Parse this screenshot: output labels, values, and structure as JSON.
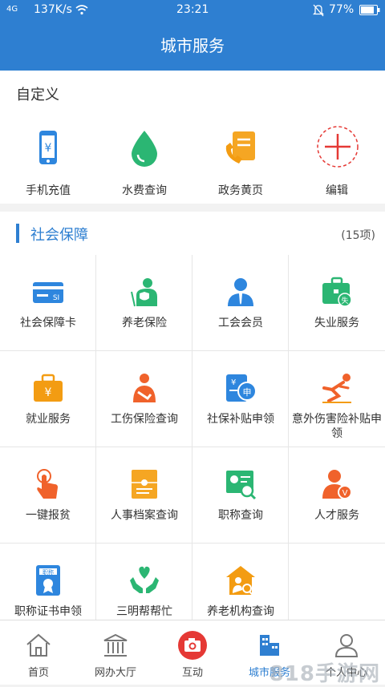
{
  "status": {
    "signal": "4G",
    "speed": "137K/s",
    "time": "23:21",
    "battery": "77%"
  },
  "appbar": {
    "title": "城市服务"
  },
  "custom": {
    "title": "自定义",
    "items": [
      {
        "label": "手机充值",
        "icon": "phone-recharge-icon"
      },
      {
        "label": "水费查询",
        "icon": "water-drop-icon"
      },
      {
        "label": "政务黄页",
        "icon": "yellow-pages-icon"
      },
      {
        "label": "编辑",
        "icon": "add-icon"
      }
    ]
  },
  "section": {
    "title": "社会保障",
    "count": "(15项)"
  },
  "grid": [
    {
      "label": "社会保障卡",
      "icon": "social-security-card-icon"
    },
    {
      "label": "养老保险",
      "icon": "pension-insurance-icon"
    },
    {
      "label": "工会会员",
      "icon": "union-member-icon"
    },
    {
      "label": "失业服务",
      "icon": "unemployment-service-icon"
    },
    {
      "label": "就业服务",
      "icon": "employment-service-icon"
    },
    {
      "label": "工伤保险查询",
      "icon": "injury-insurance-icon"
    },
    {
      "label": "社保补贴申领",
      "icon": "subsidy-apply-icon"
    },
    {
      "label": "意外伤害险补贴申领",
      "icon": "accident-insurance-icon"
    },
    {
      "label": "一键报贫",
      "icon": "one-tap-report-icon"
    },
    {
      "label": "人事档案查询",
      "icon": "personnel-file-icon"
    },
    {
      "label": "职称查询",
      "icon": "title-query-icon"
    },
    {
      "label": "人才服务",
      "icon": "talent-service-icon"
    },
    {
      "label": "职称证书申领",
      "icon": "title-certificate-icon"
    },
    {
      "label": "三明帮帮忙",
      "icon": "helping-hands-icon"
    },
    {
      "label": "养老机构查询",
      "icon": "elderly-institution-icon"
    }
  ],
  "tabs": [
    {
      "label": "首页",
      "icon": "home-icon"
    },
    {
      "label": "网办大厅",
      "icon": "hall-icon"
    },
    {
      "label": "互动",
      "icon": "camera-icon"
    },
    {
      "label": "城市服务",
      "icon": "city-service-icon",
      "active": true
    },
    {
      "label": "个人中心",
      "icon": "user-icon"
    }
  ],
  "watermark": "818手游网",
  "colors": {
    "primary": "#2e7fd1",
    "orange": "#f39c12",
    "green": "#27ae60",
    "red": "#e53935"
  }
}
